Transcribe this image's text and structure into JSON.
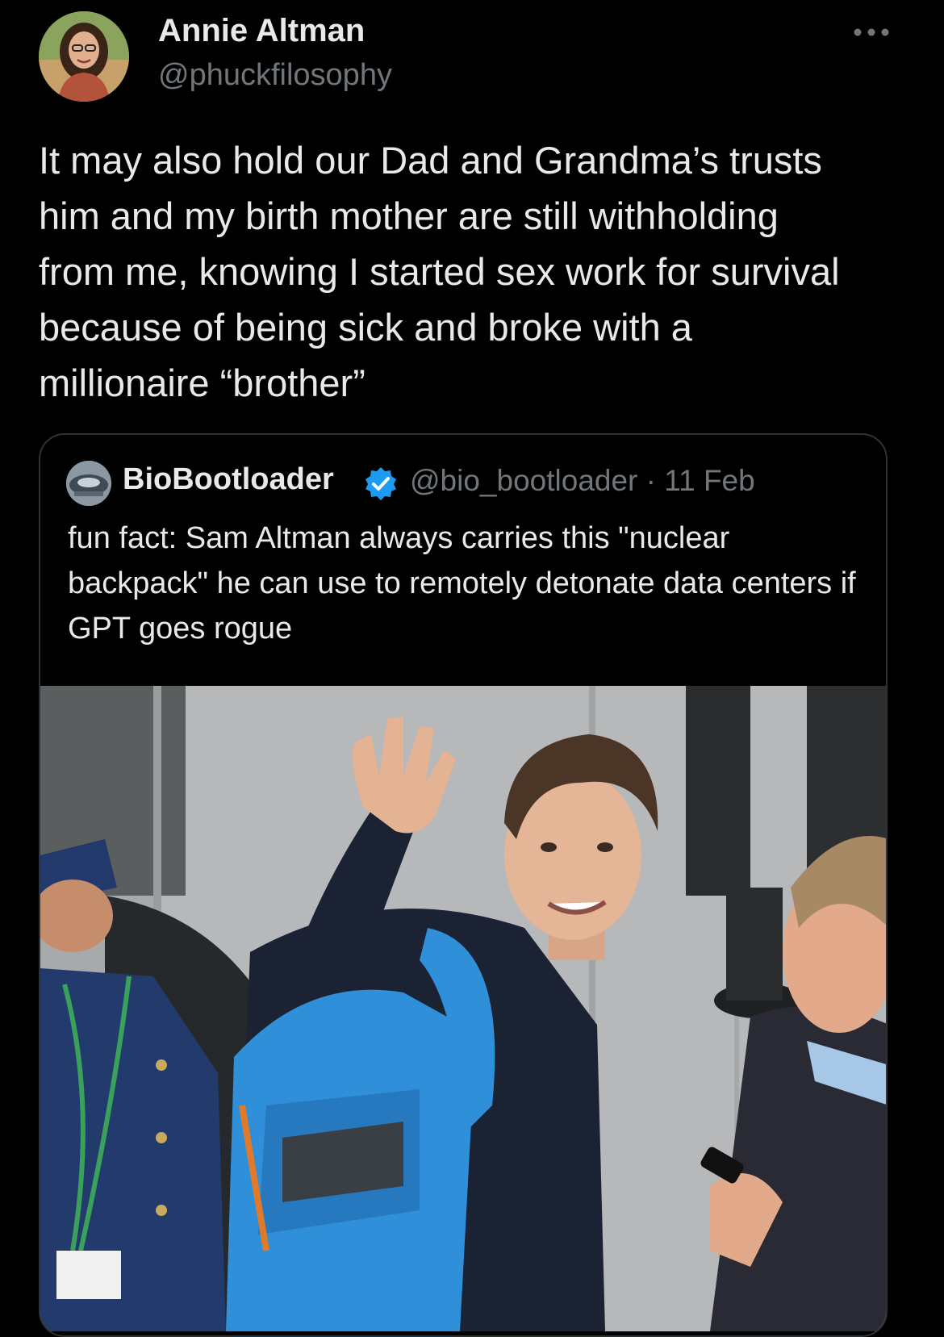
{
  "tweet": {
    "author_name": "Annie Altman",
    "author_handle": "@phuckfilosophy",
    "more_icon": "more-horizontal-icon",
    "text": "It may also hold our Dad and Grandma’s trusts\nhim and my birth mother are still withholding\nfrom me, knowing I started sex work for survival\nbecause of being sick and broke with a\nmillionaire “brother”"
  },
  "quoted_tweet": {
    "author_name": "BioBootloader",
    "verified_icon": "verified-badge-icon",
    "handle_and_time": "@bio_bootloader · 11 Feb",
    "text": "fun fact: Sam Altman always carries this \"nuclear backpack\" he can use to remotely detonate data centers if GPT goes rogue",
    "media_icon": "photo-man-waving-with-blue-backpack"
  },
  "colors": {
    "background": "#000000",
    "primary_text": "#e7e9ea",
    "secondary_text": "#71767b",
    "border": "#2f3336",
    "verified_blue": "#1d9bf0",
    "backpack_blue": "#2f8fd8"
  }
}
